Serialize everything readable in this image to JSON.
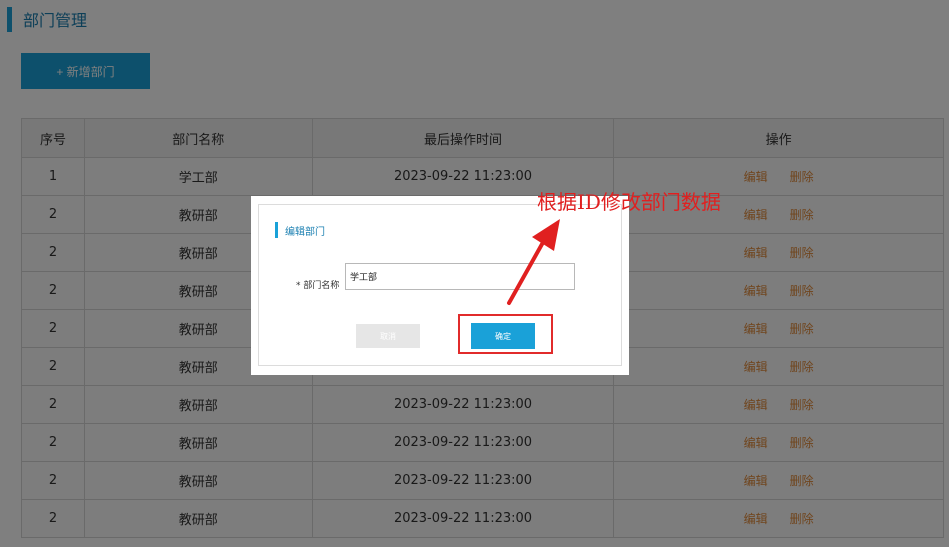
{
  "page": {
    "title": "部门管理",
    "add_button": "+ 新增部门"
  },
  "table": {
    "headers": [
      "序号",
      "部门名称",
      "最后操作时间",
      "操作"
    ],
    "rows": [
      {
        "no": "1",
        "name": "学工部",
        "time": "2023-09-22 11:23:00"
      },
      {
        "no": "2",
        "name": "教研部",
        "time": ""
      },
      {
        "no": "2",
        "name": "教研部",
        "time": ""
      },
      {
        "no": "2",
        "name": "教研部",
        "time": ""
      },
      {
        "no": "2",
        "name": "教研部",
        "time": ""
      },
      {
        "no": "2",
        "name": "教研部",
        "time": ""
      },
      {
        "no": "2",
        "name": "教研部",
        "time": "2023-09-22 11:23:00"
      },
      {
        "no": "2",
        "name": "教研部",
        "time": "2023-09-22 11:23:00"
      },
      {
        "no": "2",
        "name": "教研部",
        "time": "2023-09-22 11:23:00"
      },
      {
        "no": "2",
        "name": "教研部",
        "time": "2023-09-22 11:23:00"
      }
    ],
    "edit_label": "编辑",
    "delete_label": "删除"
  },
  "modal": {
    "title": "编辑部门",
    "field_label": "* 部门名称",
    "field_value": "学工部",
    "cancel_label": "取消",
    "confirm_label": "确定"
  },
  "annotation": {
    "text": "根据ID修改部门数据"
  },
  "colors": {
    "accent": "#1aa1d8",
    "link": "#e08a3a",
    "annotation": "#e02020"
  }
}
